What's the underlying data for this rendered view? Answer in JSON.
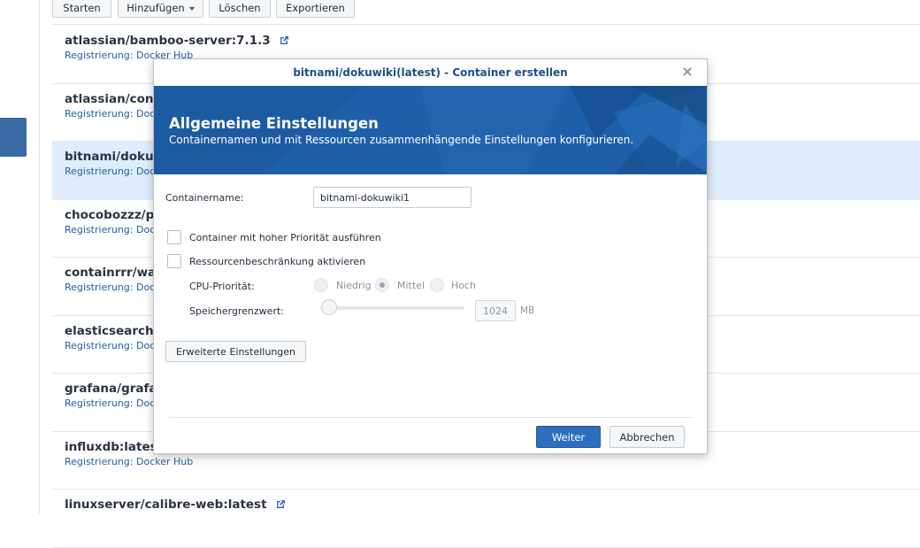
{
  "toolbar": {
    "start_label": "Starten",
    "add_label": "Hinzufügen",
    "delete_label": "Löschen",
    "export_label": "Exportieren"
  },
  "images": [
    {
      "name": "atlassian/bamboo-server:7.1.3",
      "registry": "Registrierung: Docker Hub"
    },
    {
      "name": "atlassian/con",
      "registry": "Registrierung: Doc"
    },
    {
      "name": "bitnami/doku",
      "registry": "Registrierung: Doc"
    },
    {
      "name": "chocobozzz/p",
      "registry": "Registrierung: Doc"
    },
    {
      "name": "containrrr/wa",
      "registry": "Registrierung: Doc"
    },
    {
      "name": "elasticsearch",
      "registry": "Registrierung: Doc"
    },
    {
      "name": "grafana/grafa",
      "registry": "Registrierung: Doc"
    },
    {
      "name": "influxdb:lates",
      "registry": "Registrierung: Docker Hub"
    },
    {
      "name": "linuxserver/calibre-web:latest",
      "registry": ""
    }
  ],
  "dialog": {
    "title": "bitnami/dokuwiki(latest) - Container erstellen",
    "close": "×",
    "banner_title": "Allgemeine Einstellungen",
    "banner_subtitle": "Containernamen und mit Ressourcen zusammenhängende Einstellungen konfigurieren.",
    "container_name_label": "Containername:",
    "container_name_value": "bitnami-dokuwiki1",
    "high_priority_label": "Container mit hoher Priorität ausführen",
    "resource_limit_label": "Ressourcenbeschränkung aktivieren",
    "cpu_priority_label": "CPU-Priorität:",
    "cpu_options": [
      "Niedrig",
      "Mittel",
      "Hoch"
    ],
    "cpu_selected": "Mittel",
    "memory_limit_label": "Speichergrenzwert:",
    "memory_value": "1024",
    "memory_unit": "MB",
    "advanced_button": "Erweiterte Einstellungen",
    "next_button": "Weiter",
    "cancel_button": "Abbrechen"
  },
  "colors": {
    "accent": "#2e6ebf",
    "banner": "#1d5ea8",
    "selected_row": "#dfecfa",
    "link": "#1f5fa5"
  }
}
